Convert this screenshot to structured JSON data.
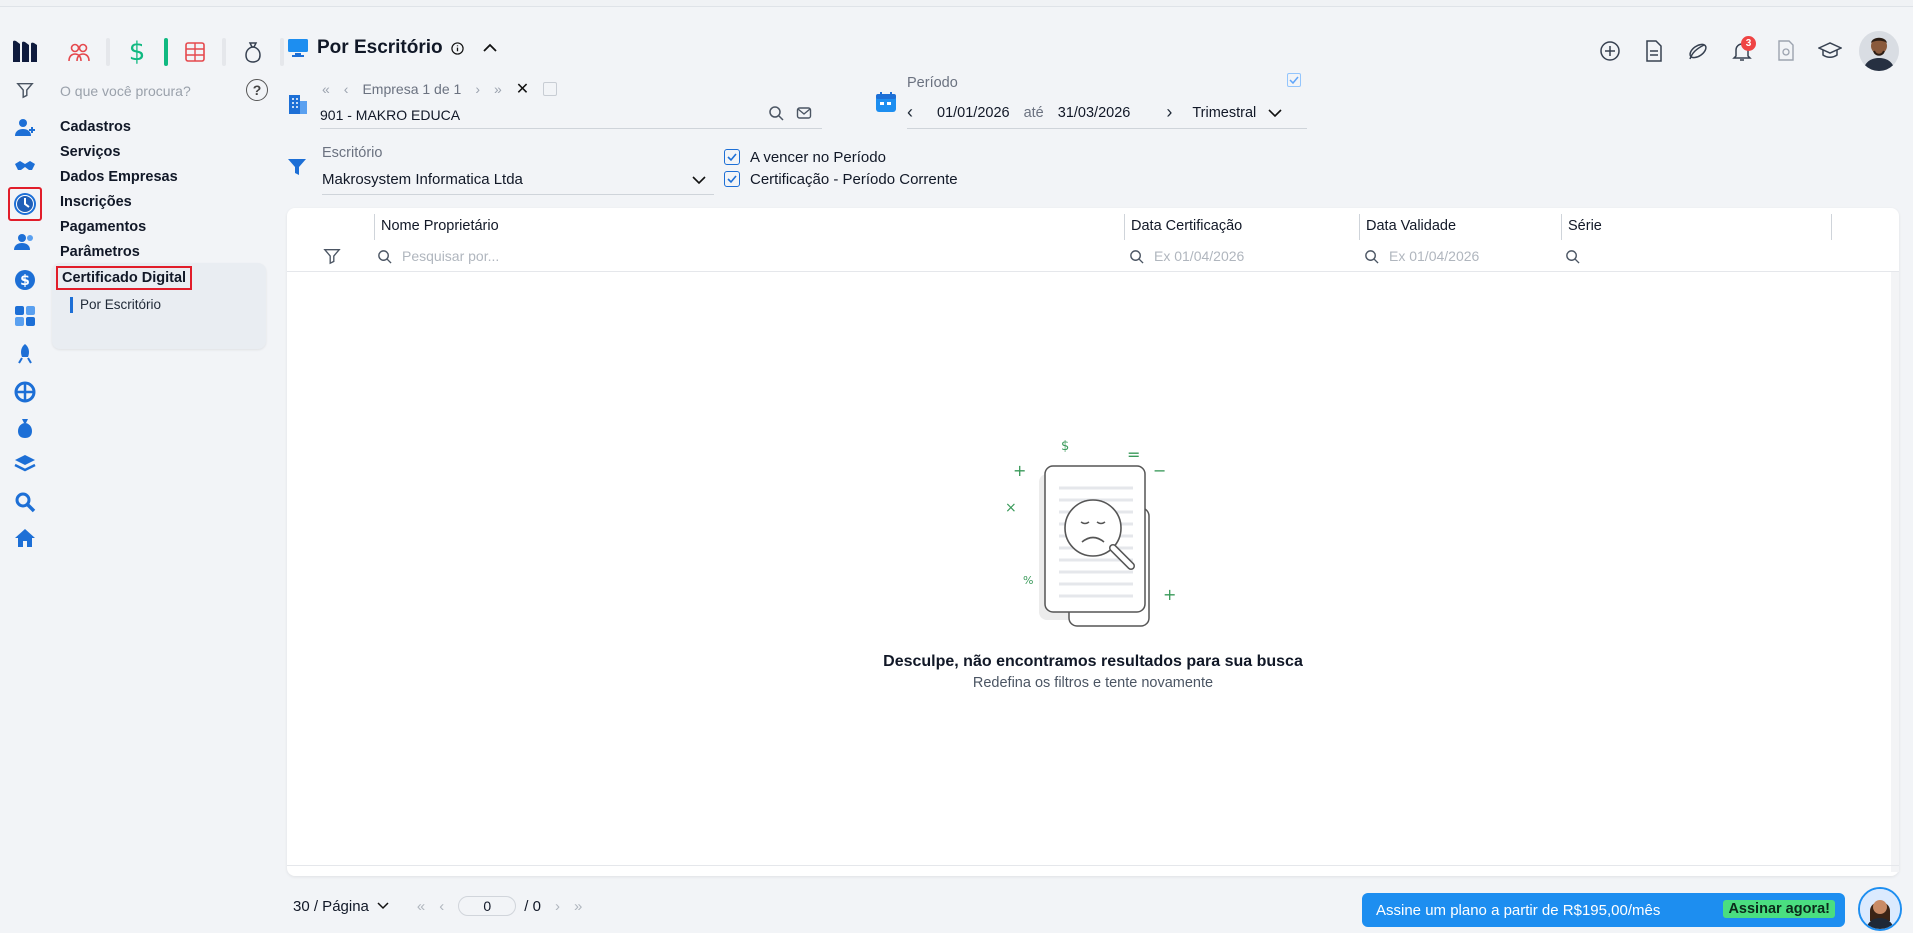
{
  "header": {
    "title": "Por Escritório"
  },
  "sidebar": {
    "search_placeholder": "O que você procura?",
    "help_label": "?",
    "menu": [
      "Cadastros",
      "Serviços",
      "Dados Empresas",
      "Inscrições",
      "Pagamentos",
      "Parâmetros"
    ],
    "active_group": "Certificado Digital",
    "active_subitem": "Por Escritório"
  },
  "filters": {
    "empresa_nav_label": "Empresa 1 de 1",
    "empresa_value": "901 - MAKRO EDUCA",
    "periodo_label": "Período",
    "date_from": "01/01/2026",
    "date_sep": "até",
    "date_to": "31/03/2026",
    "periodicity": "Trimestral",
    "escritorio_label": "Escritório",
    "escritorio_value": "Makrosystem Informatica Ltda",
    "check_a_vencer": "A vencer no Período",
    "check_certificacao": "Certificação - Período Corrente"
  },
  "notifications": {
    "count": "3"
  },
  "table": {
    "columns": [
      "Nome Proprietário",
      "Data Certificação",
      "Data Validade",
      "Série"
    ],
    "search_placeholder": "Pesquisar por...",
    "date_placeholder": "Ex 01/04/2026",
    "empty_title": "Desculpe, não encontramos resultados para sua busca",
    "empty_subtitle": "Redefina os filtros e tente novamente"
  },
  "pagination": {
    "page_size": "30 / Página",
    "current": "0",
    "total": "/ 0"
  },
  "promo": {
    "text": "Assine um plano a partir de R$195,00/mês",
    "cta": "Assinar agora!"
  },
  "colors": {
    "accent": "#1d6fd6",
    "highlight_red": "#e11d2a",
    "promo_bg": "#1d8ef0",
    "cta_green": "#4ade80"
  }
}
